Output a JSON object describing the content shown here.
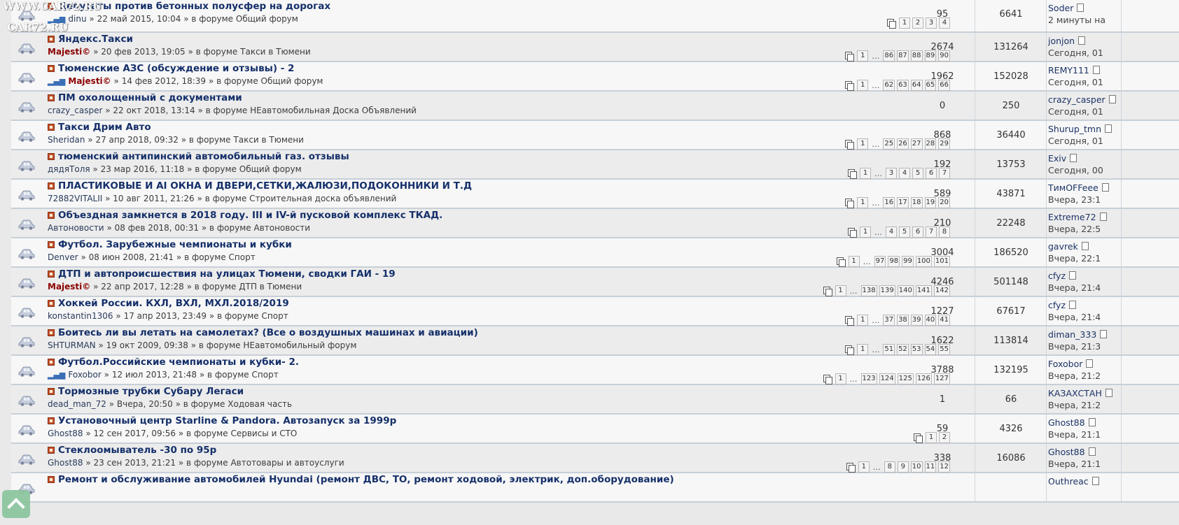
{
  "watermark": {
    "line1": "WWW.CAR72.RU",
    "line2": "CAR72.RU"
  },
  "topics": [
    {
      "title": "Депутаты против бетонных полусфер на дорогах",
      "author": "dinu",
      "author_style": "plain",
      "bars": true,
      "date": "22 май 2015, 10:04",
      "forum": "Общий форум",
      "pages": [
        "1",
        "2",
        "3",
        "4"
      ],
      "ellipsis_after": 0,
      "replies": "95",
      "views": "6641",
      "last_user": "Soder",
      "last_time": "2 минуты на"
    },
    {
      "title": "Яндекс.Такси",
      "author": "Majesti©",
      "author_style": "mod",
      "bars": false,
      "date": "20 фев 2013, 19:05",
      "forum": "Такси в Тюмени",
      "pages": [
        "1",
        "86",
        "87",
        "88",
        "89",
        "90"
      ],
      "ellipsis_after": 1,
      "replies": "2674",
      "views": "131264",
      "last_user": "jonjon",
      "last_time": "Сегодня, 01"
    },
    {
      "title": "Тюменские АЗС (обсуждение и отзывы) - 2",
      "author": "Majesti©",
      "author_style": "mod",
      "bars": true,
      "date": "14 фев 2012, 18:39",
      "forum": "Общий форум",
      "pages": [
        "1",
        "62",
        "63",
        "64",
        "65",
        "66"
      ],
      "ellipsis_after": 1,
      "replies": "1962",
      "views": "152028",
      "last_user": "REMY111",
      "last_time": "Сегодня, 01"
    },
    {
      "title": "ПМ охолощенный с документами",
      "author": "crazy_casper",
      "author_style": "plain",
      "bars": false,
      "date": "22 окт 2018, 13:14",
      "forum": "НЕавтомобильная Доска Объявлений",
      "pages": [],
      "ellipsis_after": 0,
      "replies": "0",
      "views": "250",
      "last_user": "crazy_casper",
      "last_time": "Сегодня, 01"
    },
    {
      "title": "Такси Дрим Авто",
      "author": "Sheridan",
      "author_style": "plain",
      "bars": false,
      "date": "27 апр 2018, 09:32",
      "forum": "Такси в Тюмени",
      "pages": [
        "1",
        "25",
        "26",
        "27",
        "28",
        "29"
      ],
      "ellipsis_after": 1,
      "replies": "868",
      "views": "36440",
      "last_user": "Shurup_tmn",
      "last_time": "Сегодня, 01"
    },
    {
      "title": "тюменский антипинский автомобильный газ. отзывы",
      "author": "дядяТоля",
      "author_style": "plain",
      "bars": false,
      "date": "23 мар 2016, 11:18",
      "forum": "Общий форум",
      "pages": [
        "1",
        "3",
        "4",
        "5",
        "6",
        "7"
      ],
      "ellipsis_after": 1,
      "replies": "192",
      "views": "13753",
      "last_user": "Exiv",
      "last_time": "Сегодня, 00"
    },
    {
      "title": "ПЛАСТИКОВЫЕ И AI ОКНА И ДВЕРИ,СЕТКИ,ЖАЛЮЗИ,ПОДОКОННИКИ И Т.Д",
      "author": "72882VITALII",
      "author_style": "plain",
      "bars": false,
      "date": "10 авг 2011, 21:26",
      "forum": "Строительная доска объявлений",
      "pages": [
        "1",
        "16",
        "17",
        "18",
        "19",
        "20"
      ],
      "ellipsis_after": 1,
      "replies": "589",
      "views": "43871",
      "last_user": "ТимOFFeee",
      "last_time": "Вчера, 23:1"
    },
    {
      "title": "Объездная замкнется в 2018 году. III и IV-й пусковой комплекс ТКАД.",
      "author": "Автоновости",
      "author_style": "plain",
      "bars": false,
      "date": "08 фев 2018, 00:31",
      "forum": "Автоновости",
      "pages": [
        "1",
        "4",
        "5",
        "6",
        "7",
        "8"
      ],
      "ellipsis_after": 1,
      "replies": "210",
      "views": "22248",
      "last_user": "Extreme72",
      "last_time": "Вчера, 22:5"
    },
    {
      "title": "Футбол. Зарубежные чемпионаты и кубки",
      "author": "Denver",
      "author_style": "plain",
      "bars": false,
      "date": "08 июн 2008, 21:41",
      "forum": "Спорт",
      "pages": [
        "1",
        "97",
        "98",
        "99",
        "100",
        "101"
      ],
      "ellipsis_after": 1,
      "replies": "3004",
      "views": "186520",
      "last_user": "gavrek",
      "last_time": "Вчера, 22:1"
    },
    {
      "title": "ДТП и автопроисшествия на улицах Тюмени, сводки ГАИ - 19",
      "author": "Majesti©",
      "author_style": "mod",
      "bars": false,
      "date": "22 апр 2017, 12:28",
      "forum": "ДТП в Тюмени",
      "pages": [
        "1",
        "138",
        "139",
        "140",
        "141",
        "142"
      ],
      "ellipsis_after": 1,
      "replies": "4246",
      "views": "501148",
      "last_user": "cfyz",
      "last_time": "Вчера, 21:4"
    },
    {
      "title": "Хоккей России. КХЛ, ВХЛ, МХЛ.2018/2019",
      "author": "konstantin1306",
      "author_style": "plain",
      "bars": false,
      "date": "17 апр 2013, 23:49",
      "forum": "Спорт",
      "pages": [
        "1",
        "37",
        "38",
        "39",
        "40",
        "41"
      ],
      "ellipsis_after": 1,
      "replies": "1227",
      "views": "67617",
      "last_user": "cfyz",
      "last_time": "Вчера, 21:4"
    },
    {
      "title": "Боитесь ли вы летать на самолетах? (Все о воздушных машинах и авиации)",
      "author": "SHTURMAN",
      "author_style": "plain",
      "bars": false,
      "date": "19 окт 2009, 09:38",
      "forum": "НЕавтомобильный форум",
      "pages": [
        "1",
        "51",
        "52",
        "53",
        "54",
        "55"
      ],
      "ellipsis_after": 1,
      "replies": "1622",
      "views": "113814",
      "last_user": "diman_333",
      "last_time": "Вчера, 21:3"
    },
    {
      "title": "Футбол.Российские чемпионаты и кубки- 2.",
      "author": "Foxobor",
      "author_style": "plain",
      "bars": true,
      "date": "12 июл 2013, 21:48",
      "forum": "Спорт",
      "pages": [
        "1",
        "123",
        "124",
        "125",
        "126",
        "127"
      ],
      "ellipsis_after": 1,
      "replies": "3788",
      "views": "132195",
      "last_user": "Foxobor",
      "last_time": "Вчера, 21:2"
    },
    {
      "title": "Тормозные трубки Субару Легаси",
      "author": "dead_man_72",
      "author_style": "plain",
      "bars": false,
      "date": "Вчера, 20:50",
      "forum": "Ходовая часть",
      "pages": [],
      "ellipsis_after": 0,
      "replies": "1",
      "views": "66",
      "last_user": "КАЗАХСТАН",
      "last_time": "Вчера, 21:2"
    },
    {
      "title": "Установочный центр Starline & Pandora. Автозапуск за 1999р",
      "author": "Ghost88",
      "author_style": "plain",
      "bars": false,
      "date": "12 сен 2017, 09:56",
      "forum": "Сервисы и СТО",
      "pages": [
        "1",
        "2"
      ],
      "ellipsis_after": 0,
      "replies": "59",
      "views": "4326",
      "last_user": "Ghost88",
      "last_time": "Вчера, 21:1"
    },
    {
      "title": "Стеклоомыватель -30 по 95р",
      "author": "Ghost88",
      "author_style": "plain",
      "bars": false,
      "date": "23 сен 2013, 21:21",
      "forum": "Автотовары и автоуслуги",
      "pages": [
        "1",
        "8",
        "9",
        "10",
        "11",
        "12"
      ],
      "ellipsis_after": 1,
      "replies": "338",
      "views": "16086",
      "last_user": "Ghost88",
      "last_time": "Вчера, 21:1"
    },
    {
      "title": "Ремонт и обслуживание автомобилей Hyundai (ремонт ДВС, ТО, ремонт ходовой, электрик, доп.оборудование)",
      "author": "",
      "author_style": "plain",
      "bars": false,
      "date": "",
      "forum": "",
      "pages": [],
      "ellipsis_after": 0,
      "replies": "",
      "views": "",
      "last_user": "Outhreac",
      "last_time": ""
    }
  ],
  "labels": {
    "sep": "»",
    "in_forum": "в форуме",
    "ellipsis": "…"
  }
}
